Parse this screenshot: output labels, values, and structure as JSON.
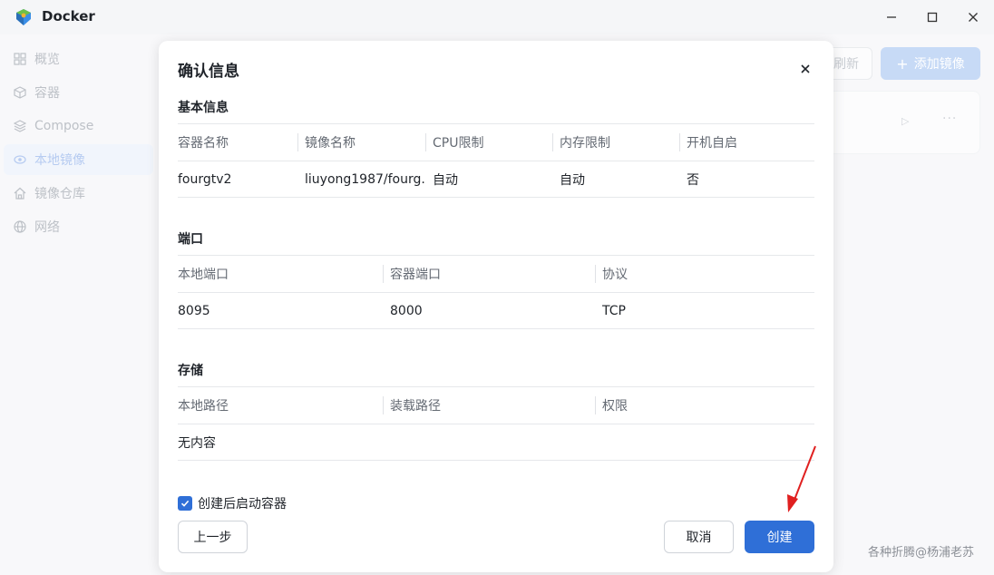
{
  "window": {
    "title": "Docker"
  },
  "sidebar": {
    "items": [
      {
        "label": "概览",
        "icon": "grid-icon"
      },
      {
        "label": "容器",
        "icon": "cube-icon"
      },
      {
        "label": "Compose",
        "icon": "layers-icon"
      },
      {
        "label": "本地镜像",
        "icon": "eye-icon"
      },
      {
        "label": "镜像仓库",
        "icon": "home-icon"
      },
      {
        "label": "网络",
        "icon": "globe-icon"
      }
    ],
    "active_index": 3
  },
  "toolbar": {
    "refresh_label": "刷新",
    "add_image_label": "添加镜像"
  },
  "dialog": {
    "title": "确认信息",
    "basic": {
      "title": "基本信息",
      "headers": [
        "容器名称",
        "镜像名称",
        "CPU限制",
        "内存限制",
        "开机自启"
      ],
      "values": [
        "fourgtv2",
        "liuyong1987/fourg...",
        "自动",
        "自动",
        "否"
      ]
    },
    "ports": {
      "title": "端口",
      "headers": [
        "本地端口",
        "容器端口",
        "协议"
      ],
      "values": [
        "8095",
        "8000",
        "TCP"
      ]
    },
    "storage": {
      "title": "存储",
      "headers": [
        "本地路径",
        "装载路径",
        "权限"
      ],
      "empty_text": "无内容"
    },
    "start_after_create": {
      "label": "创建后启动容器",
      "checked": true
    },
    "prev_label": "上一步",
    "cancel_label": "取消",
    "create_label": "创建"
  },
  "watermark": "各种折腾@杨浦老苏",
  "colors": {
    "primary": "#2f6fd7",
    "annotation_arrow": "#e02020"
  }
}
